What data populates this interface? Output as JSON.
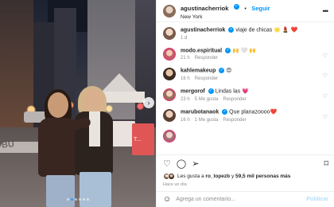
{
  "post": {
    "username": "agustinacherriok",
    "follow_label": "Seguir",
    "location": "New York",
    "more_icon": "more-horizontal-icon"
  },
  "caption": {
    "username": "agustinacherriok",
    "text": "viaje de chicas 🌟 💄 ❤️",
    "time": "1 d"
  },
  "comments": [
    {
      "username": "modo.espiritual",
      "text": "🙌 🤍 🙌",
      "time": "21 h",
      "likes": "",
      "reply": "Responder"
    },
    {
      "username": "kahlemakeup",
      "text": "😍",
      "time": "16 h",
      "likes": "",
      "reply": "Responder"
    },
    {
      "username": "mergorof",
      "text": "Lindas las 💗",
      "time": "23 h",
      "likes": "5 Me gusta",
      "reply": "Responder"
    },
    {
      "username": "marubotanaok",
      "text": "Que planazoooo❤️",
      "time": "16 h",
      "likes": "1 Me gusta",
      "reply": "Responder"
    }
  ],
  "photo": {
    "street_text": "BU",
    "box_text": "T..."
  },
  "actions": {
    "likes_prefix": "Les gusta a",
    "likes_user": "ro_lopezb",
    "likes_joiner": "y",
    "likes_count": "59,5 mil personas más",
    "time_ago": "Hace un día"
  },
  "add_comment": {
    "placeholder": "Agrega un comentario...",
    "publish_label": "Publicar"
  },
  "carousel": {
    "total": 6,
    "active": 1
  },
  "colors": {
    "accent": "#0095f6",
    "verified": "#0095f6",
    "publish_disabled": "#b2dffc"
  }
}
